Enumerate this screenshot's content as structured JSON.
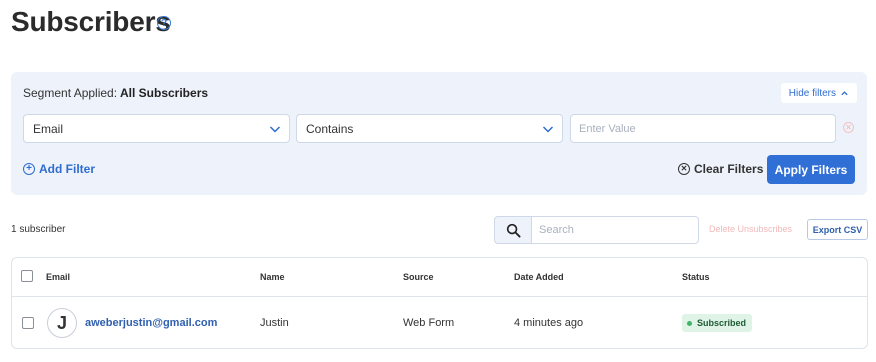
{
  "page": {
    "title": "Subscribers",
    "help_glyph": "?"
  },
  "filters": {
    "segment_label": "Segment Applied:",
    "segment_value": "All Subscribers",
    "hide_filters_label": "Hide filters",
    "field_select": "Email",
    "operator_select": "Contains",
    "value_placeholder": "Enter Value",
    "add_filter_label": "Add Filter",
    "clear_filters_label": "Clear Filters",
    "apply_filters_label": "Apply Filters"
  },
  "toolbar": {
    "count_label": "1 subscriber",
    "search_placeholder": "Search",
    "delete_unsubscribes_label": "Delete Unsubscribes",
    "export_csv_label": "Export CSV"
  },
  "table": {
    "columns": [
      "Email",
      "Name",
      "Source",
      "Date Added",
      "Status"
    ],
    "rows": [
      {
        "avatar_initial": "J",
        "email": "aweberjustin@gmail.com",
        "name": "Justin",
        "source": "Web Form",
        "date_added": "4 minutes ago",
        "status": "Subscribed"
      }
    ]
  },
  "colors": {
    "primary": "#2f6fd6",
    "link": "#2f5fae",
    "panel_bg": "#eef3fb",
    "status_bg": "#dff3e6",
    "status_dot": "#3fb56a",
    "danger_muted": "#f3b9b9"
  },
  "icons": {
    "help": "help-circle-icon",
    "hide_filters": "chevron-up-icon",
    "select": "chevron-down-icon",
    "remove": "close-circle-icon",
    "add": "plus-circle-icon",
    "clear": "x-circle-icon",
    "search": "search-icon"
  }
}
